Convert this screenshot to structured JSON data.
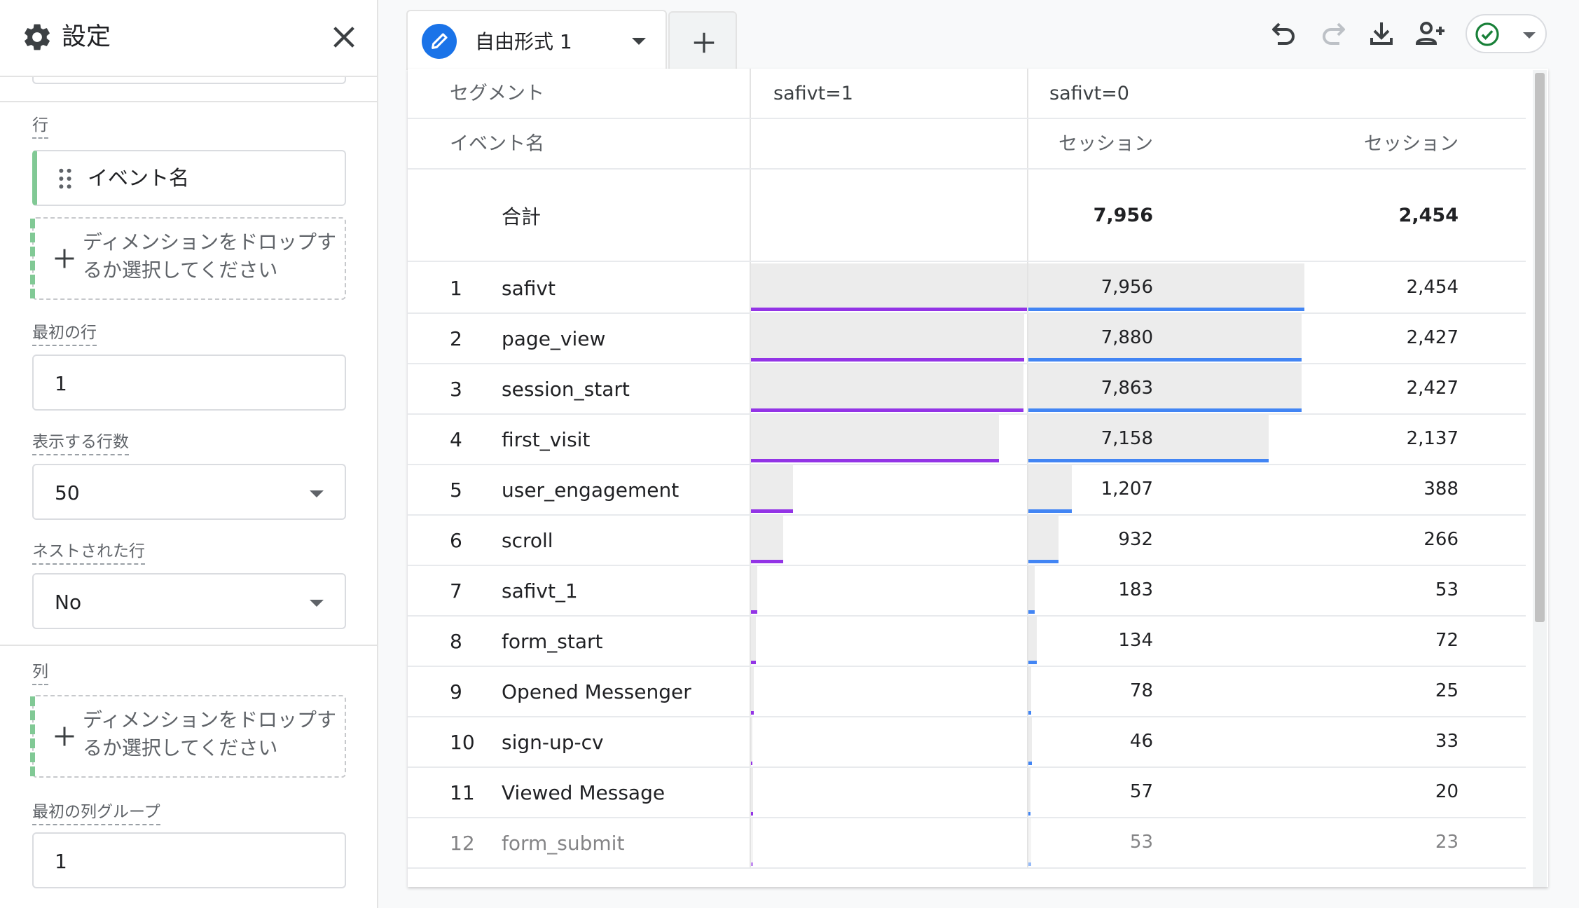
{
  "panel": {
    "title": "設定",
    "rows_section_label": "行",
    "row_chip_label": "イベント名",
    "row_drop_placeholder": "ディメンションをドロップするか選択してください",
    "first_row_label": "最初の行",
    "first_row_value": "1",
    "rows_shown_label": "表示する行数",
    "rows_shown_value": "50",
    "nested_rows_label": "ネストされた行",
    "nested_rows_value": "No",
    "columns_section_label": "列",
    "column_drop_placeholder": "ディメンションをドロップするか選択してください",
    "first_col_group_label": "最初の列グループ",
    "first_col_group_value": "1"
  },
  "tabs": [
    {
      "label": "自由形式 1",
      "active": true
    }
  ],
  "icons": {
    "settings": "gear-icon",
    "close": "close-icon",
    "tab_edit": "pencil-icon",
    "add_tab": "plus-icon",
    "undo": "undo-icon",
    "redo": "redo-icon",
    "download": "download-icon",
    "share": "person-add-icon",
    "status": "check-circle-icon"
  },
  "colors": {
    "accent_blue": "#1a73e8",
    "series1_bar": "#9334e6",
    "series2_bar": "#4285f4",
    "status_green": "#188038",
    "chip_green": "#81c995"
  },
  "table": {
    "segment_header": "セグメント",
    "dimension_header": "イベント名",
    "segments": [
      "safivt=1",
      "safivt=0"
    ],
    "metric_header": "セッション",
    "total_label": "合計",
    "totals": [
      "7,956",
      "2,454"
    ],
    "rows": [
      {
        "index": "1",
        "name": "safivt",
        "s1": "7,956",
        "s2": "2,454"
      },
      {
        "index": "2",
        "name": "page_view",
        "s1": "7,880",
        "s2": "2,427"
      },
      {
        "index": "3",
        "name": "session_start",
        "s1": "7,863",
        "s2": "2,427"
      },
      {
        "index": "4",
        "name": "first_visit",
        "s1": "7,158",
        "s2": "2,137"
      },
      {
        "index": "5",
        "name": "user_engagement",
        "s1": "1,207",
        "s2": "388"
      },
      {
        "index": "6",
        "name": "scroll",
        "s1": "932",
        "s2": "266"
      },
      {
        "index": "7",
        "name": "safivt_1",
        "s1": "183",
        "s2": "53"
      },
      {
        "index": "8",
        "name": "form_start",
        "s1": "134",
        "s2": "72"
      },
      {
        "index": "9",
        "name": "Opened Messenger",
        "s1": "78",
        "s2": "25"
      },
      {
        "index": "10",
        "name": "sign-up-cv",
        "s1": "46",
        "s2": "33"
      },
      {
        "index": "11",
        "name": "Viewed Message",
        "s1": "57",
        "s2": "20"
      },
      {
        "index": "12",
        "name": "form_submit",
        "s1": "53",
        "s2": "23"
      }
    ]
  }
}
